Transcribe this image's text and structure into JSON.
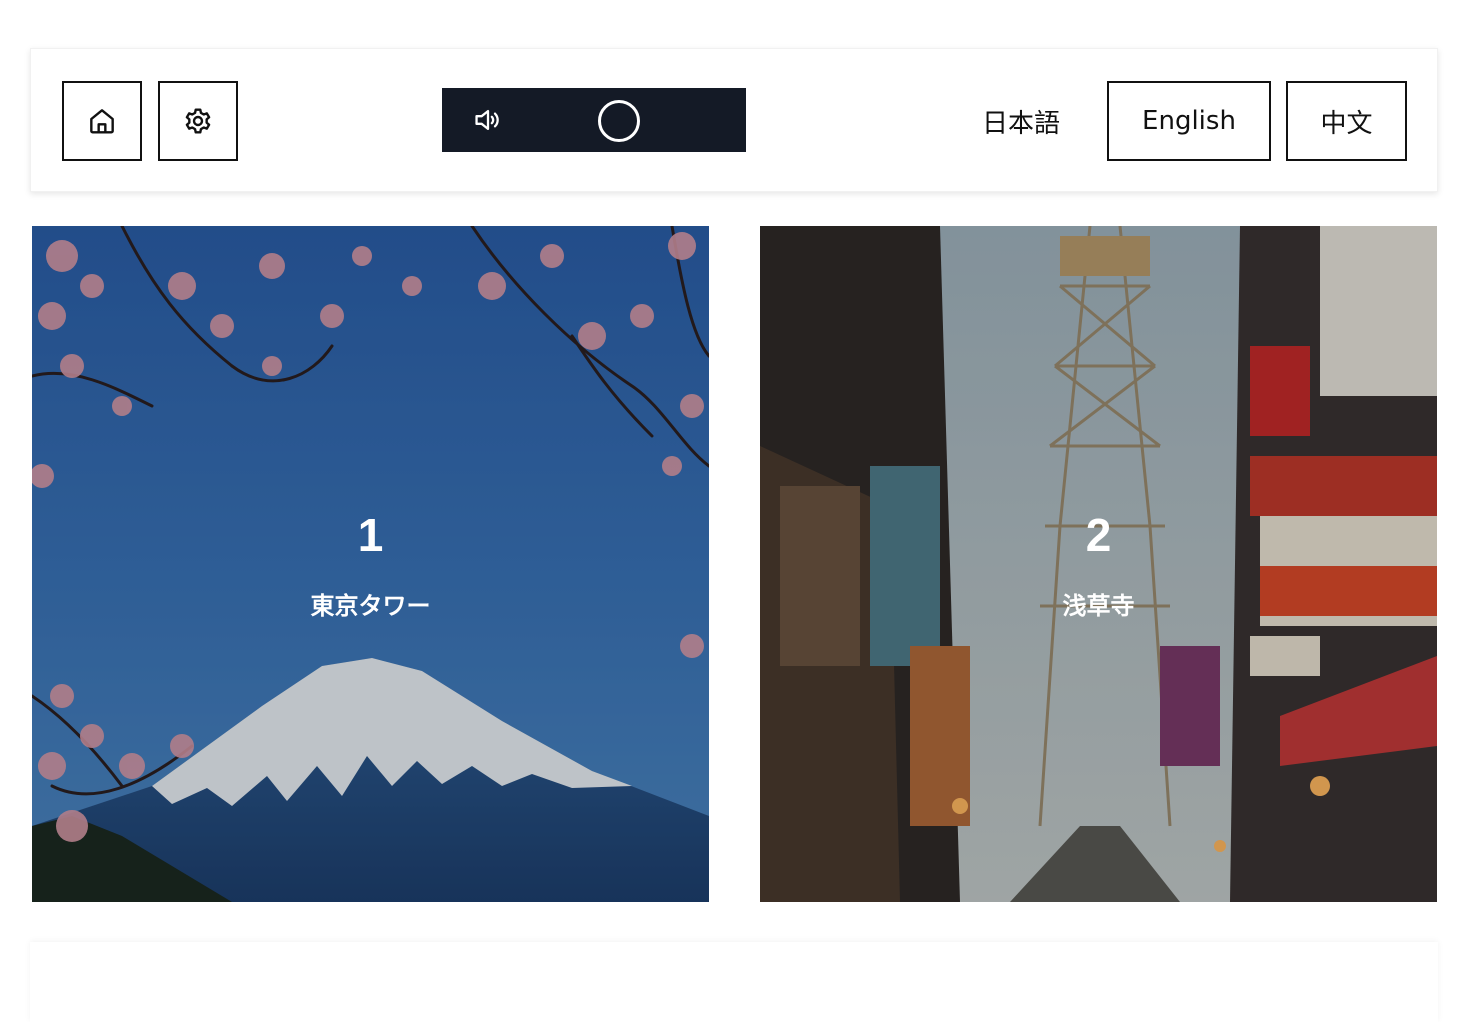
{
  "toolbar": {
    "home_icon": "home-icon",
    "settings_icon": "gear-icon",
    "audio": {
      "speaker_icon": "speaker-icon",
      "background": "#141a26"
    },
    "languages": {
      "japanese": "日本語",
      "english": "English",
      "chinese": "中文"
    }
  },
  "cards": [
    {
      "number": "1",
      "label": "東京タワー"
    },
    {
      "number": "2",
      "label": "浅草寺"
    }
  ]
}
